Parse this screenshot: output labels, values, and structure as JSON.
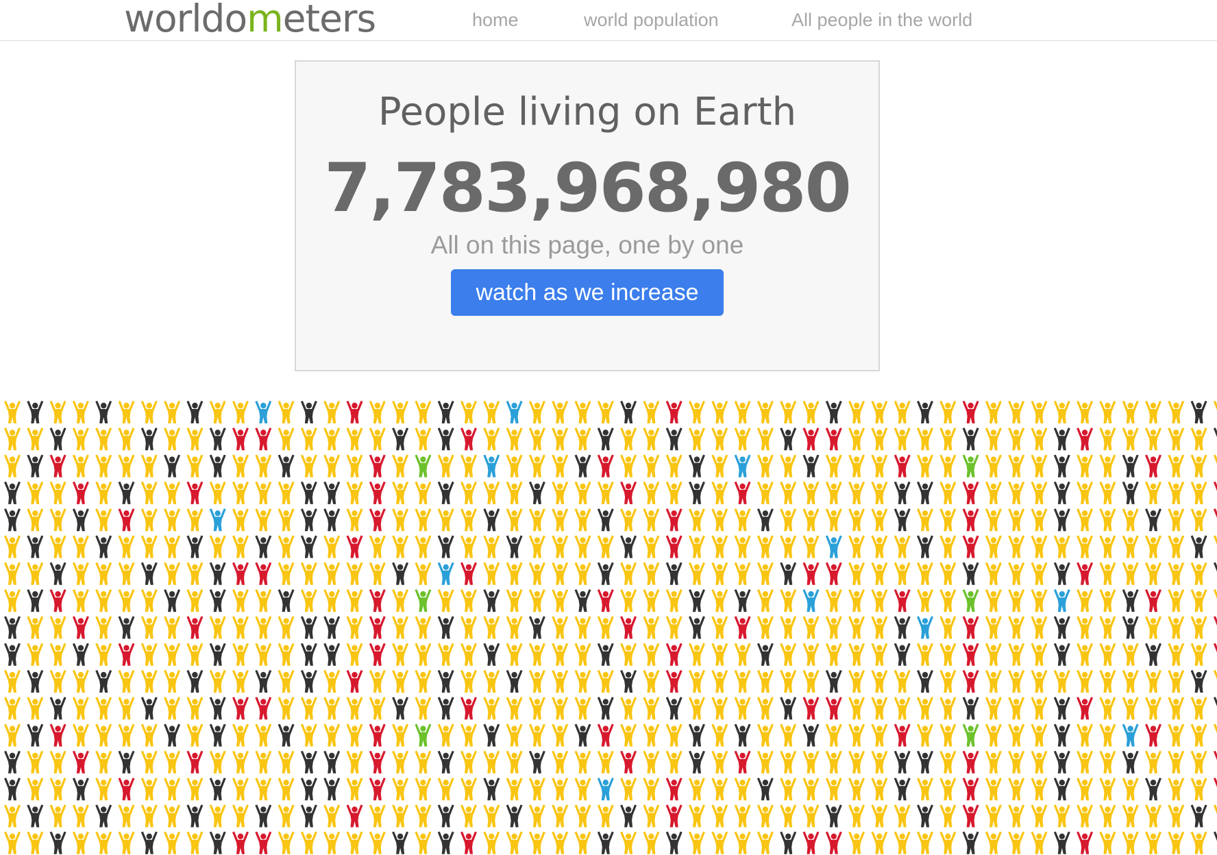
{
  "header": {
    "logo_text": "worldometers",
    "nav": [
      {
        "label": "home"
      },
      {
        "label": "world population"
      },
      {
        "label": "All people in the world"
      }
    ]
  },
  "panel": {
    "title": "People living on Earth",
    "count": "7,783,968,980",
    "subtitle": "All on this page, one by one",
    "button_label": "watch as we increase"
  },
  "people_grid": {
    "icon": "person-arms-raised-icon",
    "colors": {
      "yellow": "#f9c513",
      "black": "#333333",
      "red": "#d7192e",
      "blue": "#2ba0d8",
      "green": "#6cc12c"
    },
    "pattern": [
      "YBYYBYYYBYYBYBYRYYYBYYBYYYYBYRYYYYYYBYYYBYRYYYYYYYYYBYYYRYYYBYYYYB",
      "YYBYYYBYYBRRYYYYYBYBRYYYYYBYYBYYYYBRRYYYYYBYYYBRYYYYYBYYBYYYYYBRRY",
      "YBRYYYYBYBYYBYYYRYGYYBYYYBRYYYBYBYYBYYYRYYGYYYBYYBRYYYYBYBYYBYYYRY",
      "BYYRYBYYRYYYYBBYRYYBYYYBYYYRYYBYRYYYYYYBBYRYYYBYYBYYYRYYBYRYYYYYBB",
      "BYYBYRYYYBYYYBBYRYYYYBYYYYBYYRYYYBYYYYYBYYRYYYBYYYBYYRYYYBYYRYYYBY"
    ]
  }
}
